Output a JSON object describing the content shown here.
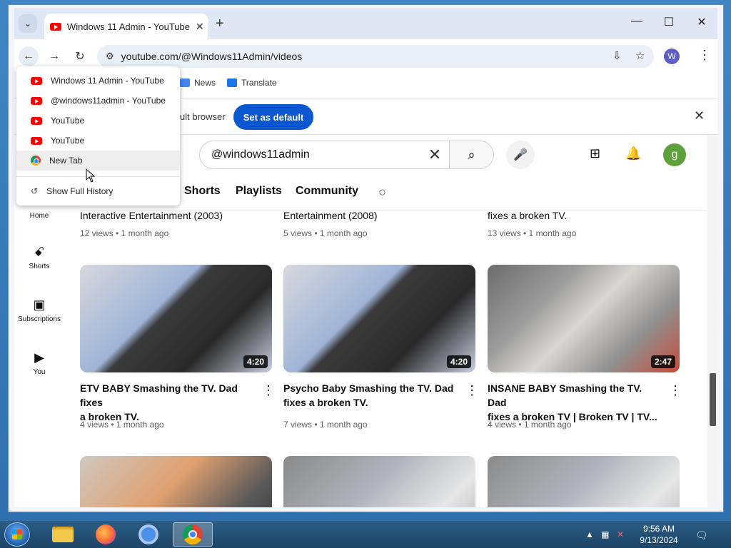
{
  "browser": {
    "tab_title": "Windows 11 Admin - YouTube",
    "new_tab_symbol": "+",
    "url": "youtube.com/@Windows11Admin/videos",
    "profile_initial": "W",
    "window_controls": {
      "minimize": "—",
      "maximize": "☐",
      "close": "✕"
    }
  },
  "bookmarks": [
    {
      "label": "News"
    },
    {
      "label": "Translate"
    }
  ],
  "infobar": {
    "text": "ult browser",
    "button": "Set as default",
    "close": "✕"
  },
  "history_menu": {
    "items": [
      {
        "label": "Windows 11 Admin - YouTube",
        "icon": "youtube-icon"
      },
      {
        "label": "@windows11admin - YouTube",
        "icon": "youtube-icon"
      },
      {
        "label": "YouTube",
        "icon": "youtube-icon"
      },
      {
        "label": "YouTube",
        "icon": "youtube-icon"
      },
      {
        "label": "New Tab",
        "icon": "chrome-icon"
      }
    ],
    "show_full_history": "Show Full History"
  },
  "youtube": {
    "search_value": "@windows11admin",
    "user_initial": "g",
    "sidebar": [
      {
        "label": "Home"
      },
      {
        "label": "Shorts"
      },
      {
        "label": "Subscriptions"
      },
      {
        "label": "You"
      }
    ],
    "channel_tabs": [
      "Shorts",
      "Playlists",
      "Community"
    ],
    "top_row": [
      {
        "title_tail": "Interactive Entertainment (2003)",
        "meta": "12 views • 1 month ago"
      },
      {
        "title_tail": "Entertainment (2008)",
        "meta": "5 views • 1 month ago"
      },
      {
        "title_tail": "fixes a broken TV.",
        "meta": "13 views • 1 month ago"
      }
    ],
    "videos": [
      {
        "title_line1": "ETV BABY Smashing the TV. Dad fixes",
        "title_line2": "a broken TV.",
        "duration": "4:20",
        "meta": "4 views • 1 month ago"
      },
      {
        "title_line1": "Psycho Baby Smashing the TV. Dad",
        "title_line2": "fixes a broken TV.",
        "duration": "4:20",
        "meta": "7 views • 1 month ago"
      },
      {
        "title_line1": "INSANE BABY Smashing the TV. Dad",
        "title_line2": "fixes a broken TV | Broken TV | TV...",
        "duration": "2:47",
        "meta": "4 views • 1 month ago"
      }
    ]
  },
  "taskbar": {
    "time": "9:56 AM",
    "date": "9/13/2024"
  },
  "colors": {
    "youtube_red": "#ff0000",
    "chrome_blue": "#0b57d0",
    "avatar_green": "#5ea03b",
    "profile_purple": "#5b5fc7"
  }
}
